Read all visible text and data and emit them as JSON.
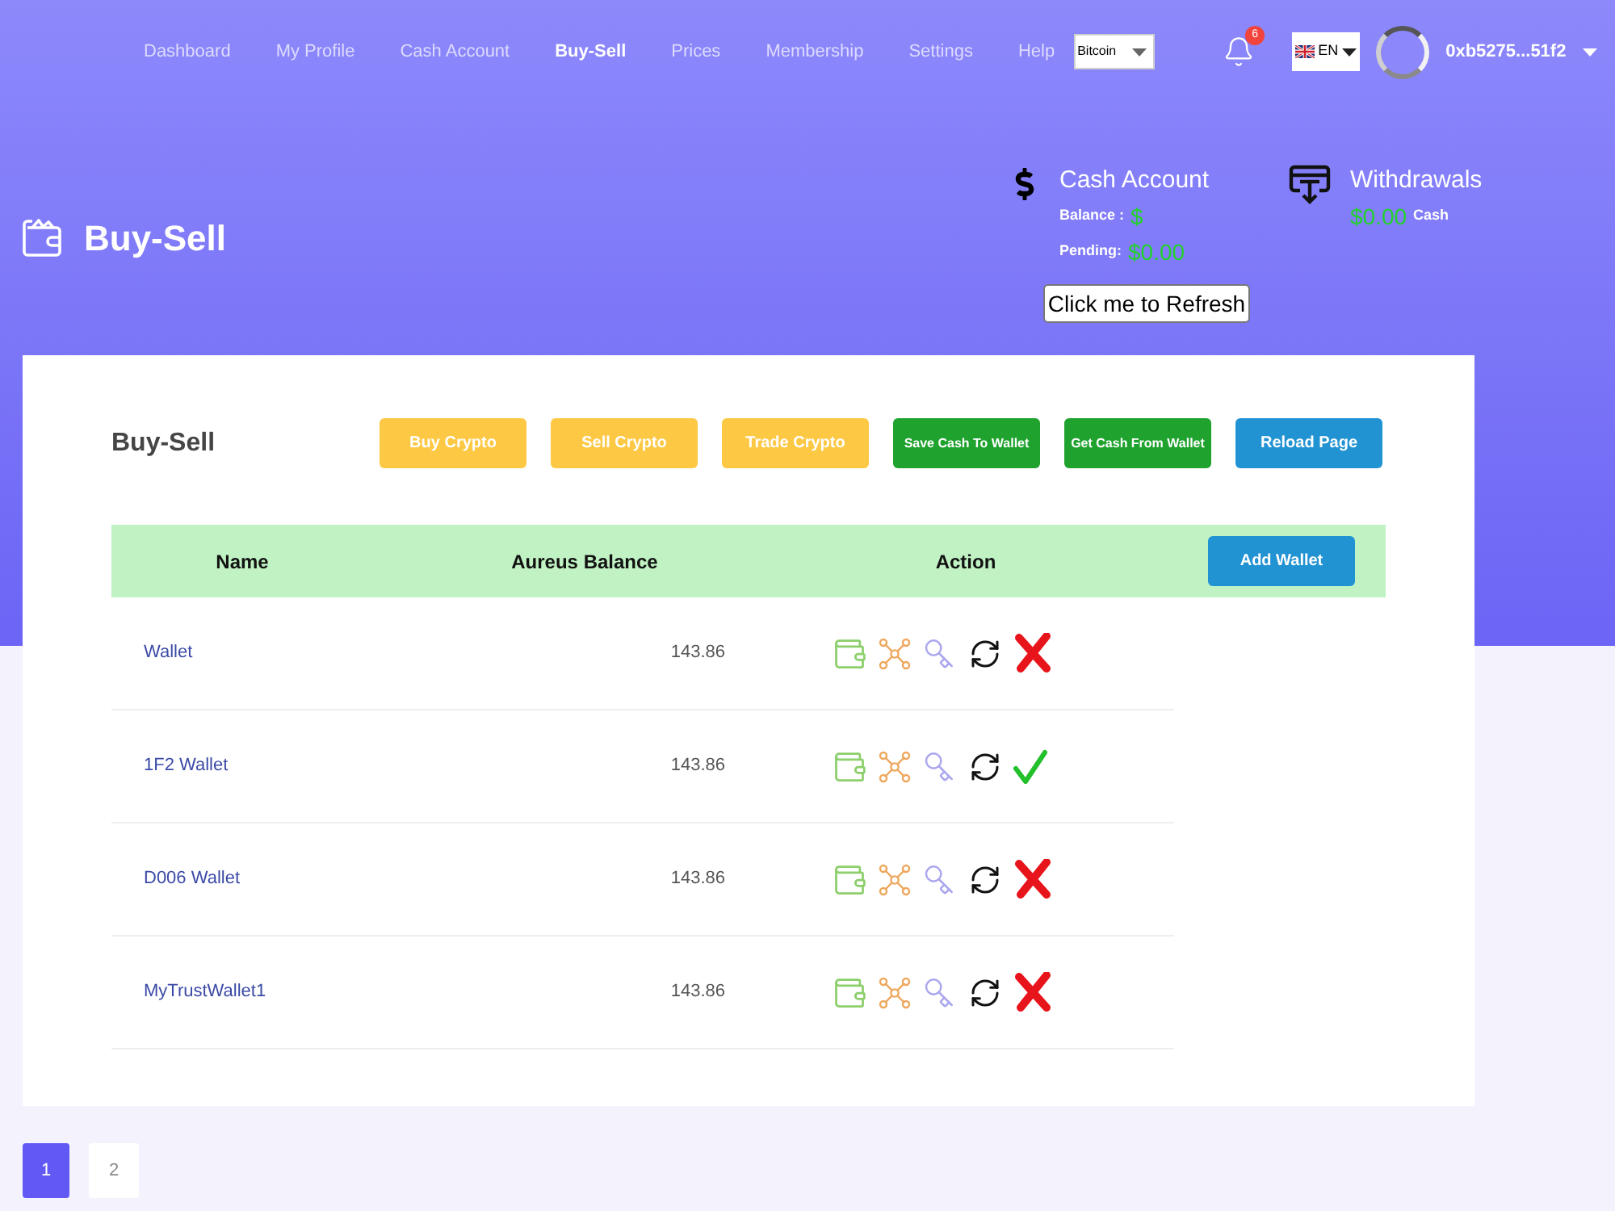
{
  "nav": {
    "items": [
      {
        "label": "Dashboard",
        "selected": false
      },
      {
        "label": "My Profile",
        "selected": false
      },
      {
        "label": "Cash Account",
        "selected": false
      },
      {
        "label": "Buy-Sell",
        "selected": true
      },
      {
        "label": "Prices",
        "selected": false
      },
      {
        "label": "Membership",
        "selected": false
      },
      {
        "label": "Settings",
        "selected": false
      },
      {
        "label": "Help",
        "selected": false
      }
    ],
    "currency_select": {
      "value": "Bitcoin"
    },
    "notifications": {
      "count": "6"
    },
    "language_select": {
      "value": "EN"
    },
    "account": {
      "address": "0xb5275...51f2"
    }
  },
  "header": {
    "title": "Buy-Sell",
    "cash_account": {
      "title": "Cash Account",
      "balance_label": "Balance :",
      "balance_value": "$",
      "pending_label": "Pending:",
      "pending_value": "$0.00"
    },
    "withdrawals": {
      "title": "Withdrawals",
      "amount": "$0.00",
      "unit": "Cash"
    },
    "refresh_button": "Click me to Refresh"
  },
  "panel": {
    "title": "Buy-Sell",
    "buttons": [
      {
        "label": "Buy Crypto",
        "kind": "warning"
      },
      {
        "label": "Sell Crypto",
        "kind": "warning"
      },
      {
        "label": "Trade Crypto",
        "kind": "warning"
      },
      {
        "label": "Save Cash To Wallet",
        "kind": "success"
      },
      {
        "label": "Get Cash From Wallet",
        "kind": "success"
      },
      {
        "label": "Reload Page",
        "kind": "info"
      }
    ]
  },
  "table": {
    "columns": [
      "Name",
      "Aureus Balance",
      "Action"
    ],
    "add_button": "Add Wallet",
    "rows": [
      {
        "name": "Wallet",
        "balance": "143.86",
        "active": false
      },
      {
        "name": "1F2 Wallet",
        "balance": "143.86",
        "active": true
      },
      {
        "name": "D006 Wallet",
        "balance": "143.86",
        "active": false
      },
      {
        "name": "MyTrustWallet1",
        "balance": "143.86",
        "active": false
      }
    ]
  },
  "pagination": [
    {
      "label": "1",
      "selected": true
    },
    {
      "label": "2",
      "selected": false
    }
  ]
}
